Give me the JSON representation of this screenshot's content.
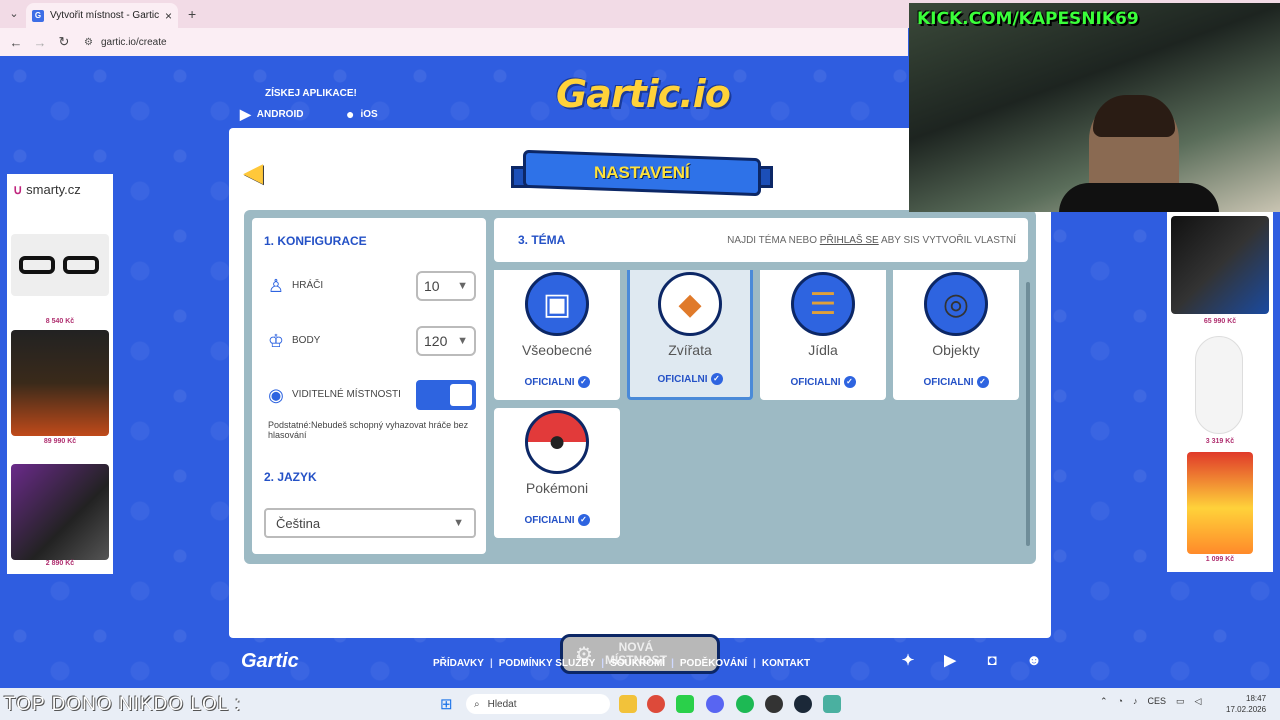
{
  "browser": {
    "tab_title": "Vytvořit místnost - Gartic.io",
    "url": "gartic.io/create",
    "new_tab": "+",
    "close": "×"
  },
  "header": {
    "get_app": "ZÍSKEJ APLIKACE!",
    "android": "ANDROID",
    "ios": "iOS",
    "logo": "Gartic.io"
  },
  "banner": {
    "title": "NASTAVENÍ"
  },
  "config": {
    "title": "1. KONFIGURACE",
    "players_label": "HRÁČI",
    "players_value": "10",
    "points_label": "BODY",
    "points_value": "120",
    "visible_label": "VIDITELNÉ MÍSTNOSTI",
    "note": "Podstatné:Nebudeš schopný vyhazovat hráče bez hlasování",
    "lang_title": "2. JAZYK",
    "lang_value": "Čeština"
  },
  "theme": {
    "title": "3. TÉMA",
    "hint_pre": "NAJDI TÉMA NEBO ",
    "hint_link": "PŘIHLAŠ SE",
    "hint_post": " ABY SIS VYTVOŘIL VLASTNÍ",
    "items": [
      {
        "name": "Všeobecné",
        "badge": "OFICIALNI",
        "icon": "tv-icon"
      },
      {
        "name": "Zvířata",
        "badge": "OFICIALNI",
        "icon": "dog-icon"
      },
      {
        "name": "Jídla",
        "badge": "OFICIALNI",
        "icon": "burger-icon"
      },
      {
        "name": "Objekty",
        "badge": "OFICIALNI",
        "icon": "camera-icon"
      },
      {
        "name": "Pokémoni",
        "badge": "OFICIALNI",
        "icon": "pokeball-icon"
      }
    ],
    "selected_index": 1
  },
  "new_room": {
    "line1": "NOVÁ",
    "line2": "MÍSTNOST"
  },
  "footer": {
    "logo": "Gartic",
    "links": [
      "PŘÍDAVKY",
      "PODMÍNKY SLUŽBY",
      "SOUKROMÍ",
      "PODĚKOVÁNÍ",
      "KONTAKT"
    ],
    "separator": "|"
  },
  "ads": {
    "left_brand": "smarty.cz",
    "left_prices": [
      "8 540 Kč",
      "89 990 Kč",
      "2 890 Kč"
    ],
    "right_prices": [
      "65 990 Kč",
      "3 319 Kč",
      "1 099 Kč"
    ]
  },
  "stream": {
    "cam_text": "KICK.COM/KAPESNIK69",
    "ticker": "TOP DONO NIKDO LOL :"
  },
  "taskbar": {
    "search": "Hledat",
    "lang": "CES",
    "time": "18:47",
    "date": "17.02.2026"
  },
  "colors": {
    "page_bg": "#2f5de0",
    "accent": "#2451c6",
    "banner_text": "#ffe23a",
    "panel": "#9dbac4"
  }
}
